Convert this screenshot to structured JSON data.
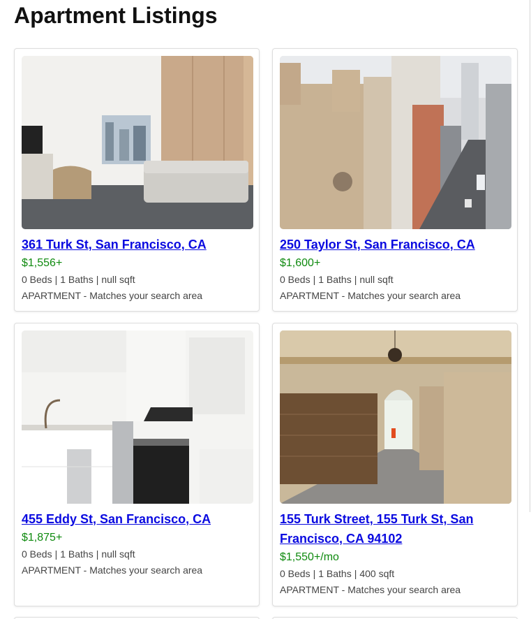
{
  "page": {
    "title": "Apartment Listings"
  },
  "listings": [
    {
      "address": "361 Turk St, San Francisco, CA",
      "price": "$1,556+",
      "beds": "0 Beds",
      "baths": "1 Baths",
      "sqft": "null sqft",
      "description": "APARTMENT - Matches your search area",
      "photo": "studio-living-room-photo"
    },
    {
      "address": "250 Taylor St, San Francisco, CA",
      "price": "$1,600+",
      "beds": "0 Beds",
      "baths": "1 Baths",
      "sqft": "null sqft",
      "description": "APARTMENT - Matches your search area",
      "photo": "street-view-photo"
    },
    {
      "address": "455 Eddy St, San Francisco, CA",
      "price": "$1,875+",
      "beds": "0 Beds",
      "baths": "1 Baths",
      "sqft": "null sqft",
      "description": "APARTMENT - Matches your search area",
      "photo": "kitchen-photo"
    },
    {
      "address": "155 Turk Street, 155 Turk St, San Francisco, CA 94102",
      "price": "$1,550+/mo",
      "beds": "0 Beds",
      "baths": "1 Baths",
      "sqft": "400 sqft",
      "description": "APARTMENT - Matches your search area",
      "photo": "lobby-hallway-photo"
    }
  ],
  "colors": {
    "link": "#0a0ae0",
    "price": "#0f8a0f",
    "text": "#444444"
  }
}
